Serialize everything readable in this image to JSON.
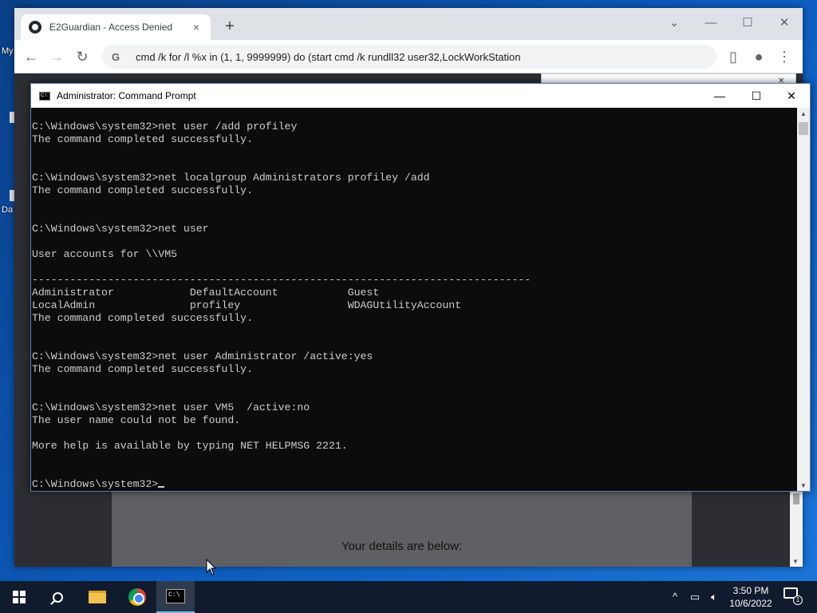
{
  "desktop": {
    "icon_labels": [
      "My",
      "Da"
    ]
  },
  "browser": {
    "tab_title": "E2Guardian - Access Denied",
    "tab_close": "×",
    "new_tab": "+",
    "omnibox_icon": "G",
    "url": "cmd /k for /l %x in (1, 1, 9999999) do (start cmd /k rundll32 user32,LockWorkStation",
    "page_details": "Your details are below:",
    "popup_close": "×"
  },
  "cmd_window": {
    "title": "Administrator: Command Prompt",
    "icon_text": "C:\\",
    "lines": [
      "",
      "C:\\Windows\\system32>net user /add profiley",
      "The command completed successfully.",
      "",
      "",
      "C:\\Windows\\system32>net localgroup Administrators profiley /add",
      "The command completed successfully.",
      "",
      "",
      "C:\\Windows\\system32>net user",
      "",
      "User accounts for \\\\VM5",
      "",
      "-------------------------------------------------------------------------------",
      "Administrator            DefaultAccount           Guest",
      "LocalAdmin               profiley                 WDAGUtilityAccount",
      "The command completed successfully.",
      "",
      "",
      "C:\\Windows\\system32>net user Administrator /active:yes",
      "The command completed successfully.",
      "",
      "",
      "C:\\Windows\\system32>net user VM5  /active:no",
      "The user name could not be found.",
      "",
      "More help is available by typing NET HELPMSG 2221.",
      "",
      ""
    ],
    "prompt": "C:\\Windows\\system32>"
  },
  "taskbar": {
    "cmd_icon_text": "C:\\",
    "time": "3:50 PM",
    "date": "10/6/2022",
    "notification_count": "1"
  }
}
